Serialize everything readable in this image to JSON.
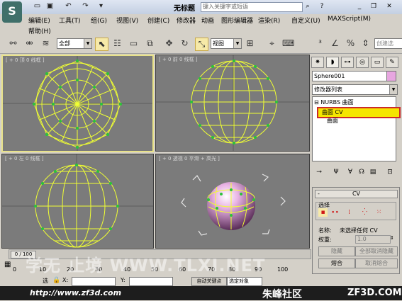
{
  "app": {
    "logo_glyph": "S",
    "title": "无标题",
    "search_placeholder": "键入关键字或短语"
  },
  "title_icons": [
    "folder-open-icon",
    "save-icon",
    "undo-icon",
    "redo-icon",
    "dropdown-icon"
  ],
  "menu": {
    "row1": [
      "编辑(E)",
      "工具(T)",
      "组(G)",
      "视图(V)",
      "创建(C)",
      "修改器",
      "动画",
      "图形编辑器",
      "渲染(R)",
      "自定义(U)",
      "MAXScript(M)"
    ],
    "row2": [
      "帮助(H)"
    ]
  },
  "toolbar": {
    "filter_value": "全部",
    "coord_value": "视图",
    "create_selection_value": "创建选"
  },
  "viewports": {
    "top": "[ + 0 顶 0 线框 ]",
    "front": "[ + 0 前 0 线框 ]",
    "left": "[ + 0 左 0 线框 ]",
    "persp": "[ + 0 透视 0 平滑 + 高光 ]",
    "colors": {
      "wire": "#f0ff33",
      "background": "#7b7b7b",
      "vertex": "#2ac43a"
    }
  },
  "command_panel": {
    "object_name": "Sphere001",
    "modifier_list": "修改器列表",
    "stack": {
      "root": "NURBS 曲面",
      "sub1": "曲面 CV",
      "sub2": "曲面"
    },
    "rollout_title": "CV",
    "selection_title": "选择",
    "name_label": "名称:",
    "name_value": "未选择任何 CV",
    "weight_label": "权重:",
    "weight_value": "1.0",
    "hide_label": "隐藏",
    "unhide_all_label": "全部取消隐藏",
    "fuse_label": "熔合",
    "unfuse_label": "取消熔合"
  },
  "timeline": {
    "position": "0 / 100",
    "ticks": [
      "0",
      "10",
      "20",
      "30",
      "40",
      "50",
      "60",
      "70",
      "80",
      "90",
      "100"
    ]
  },
  "status": {
    "select_label": "选",
    "x_label": "X:",
    "y_label": "Y:",
    "auto_key": "自动关键点",
    "selected_object": "选定对象"
  },
  "footer": {
    "url": "http://www.zf3d.com",
    "brand": "朱峰社区",
    "site": "ZF3D.COM"
  },
  "watermark": "学无 止境 WWW.TLXI.NET"
}
